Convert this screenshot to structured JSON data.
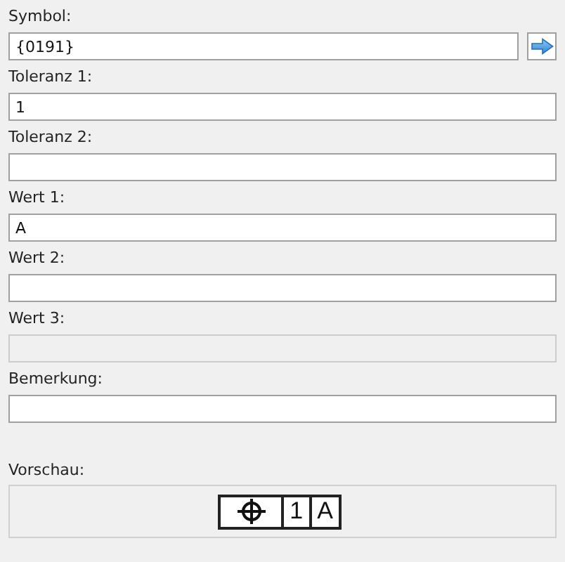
{
  "fields": [
    {
      "label": "Symbol:",
      "value": "{0191}",
      "disabled": false,
      "has_button": true
    },
    {
      "label": "Toleranz 1:",
      "value": "1",
      "disabled": false
    },
    {
      "label": "Toleranz 2:",
      "disabled": false
    },
    {
      "label": "Wert 1:",
      "value": "A",
      "disabled": false
    },
    {
      "label": "Wert 2:",
      "disabled": false
    },
    {
      "label": "Wert 3:",
      "disabled": true
    },
    {
      "label": "Bemerkung:",
      "disabled": false
    }
  ],
  "preview": {
    "label": "Vorschau:",
    "cells": [
      {
        "kind": "symbol"
      },
      {
        "kind": "text",
        "text": "1"
      },
      {
        "kind": "text",
        "text": "A"
      }
    ]
  }
}
